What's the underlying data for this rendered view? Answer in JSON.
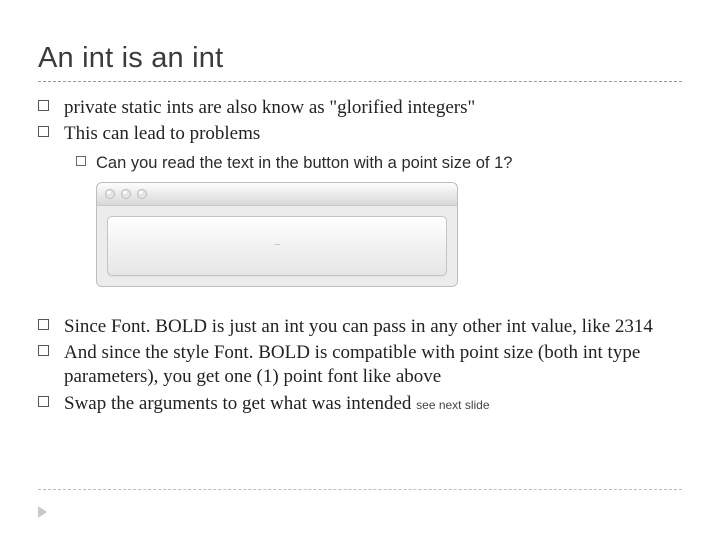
{
  "title": "An int is an int",
  "bullets": {
    "b1": "private static ints are also know as \"glorified integers\"",
    "b2": "This can lead to problems",
    "b2a": "Can you read the text in the button with a point size of 1?",
    "b3": "Since Font. BOLD is just an int you can pass in any other int value, like 2314",
    "b4": "And since the style Font. BOLD is compatible with point size (both int type parameters), you get one (1) point font like above",
    "b5": "Swap the arguments to get what was intended",
    "b5_note": "see next slide"
  },
  "mock": {
    "button_label": "—"
  }
}
